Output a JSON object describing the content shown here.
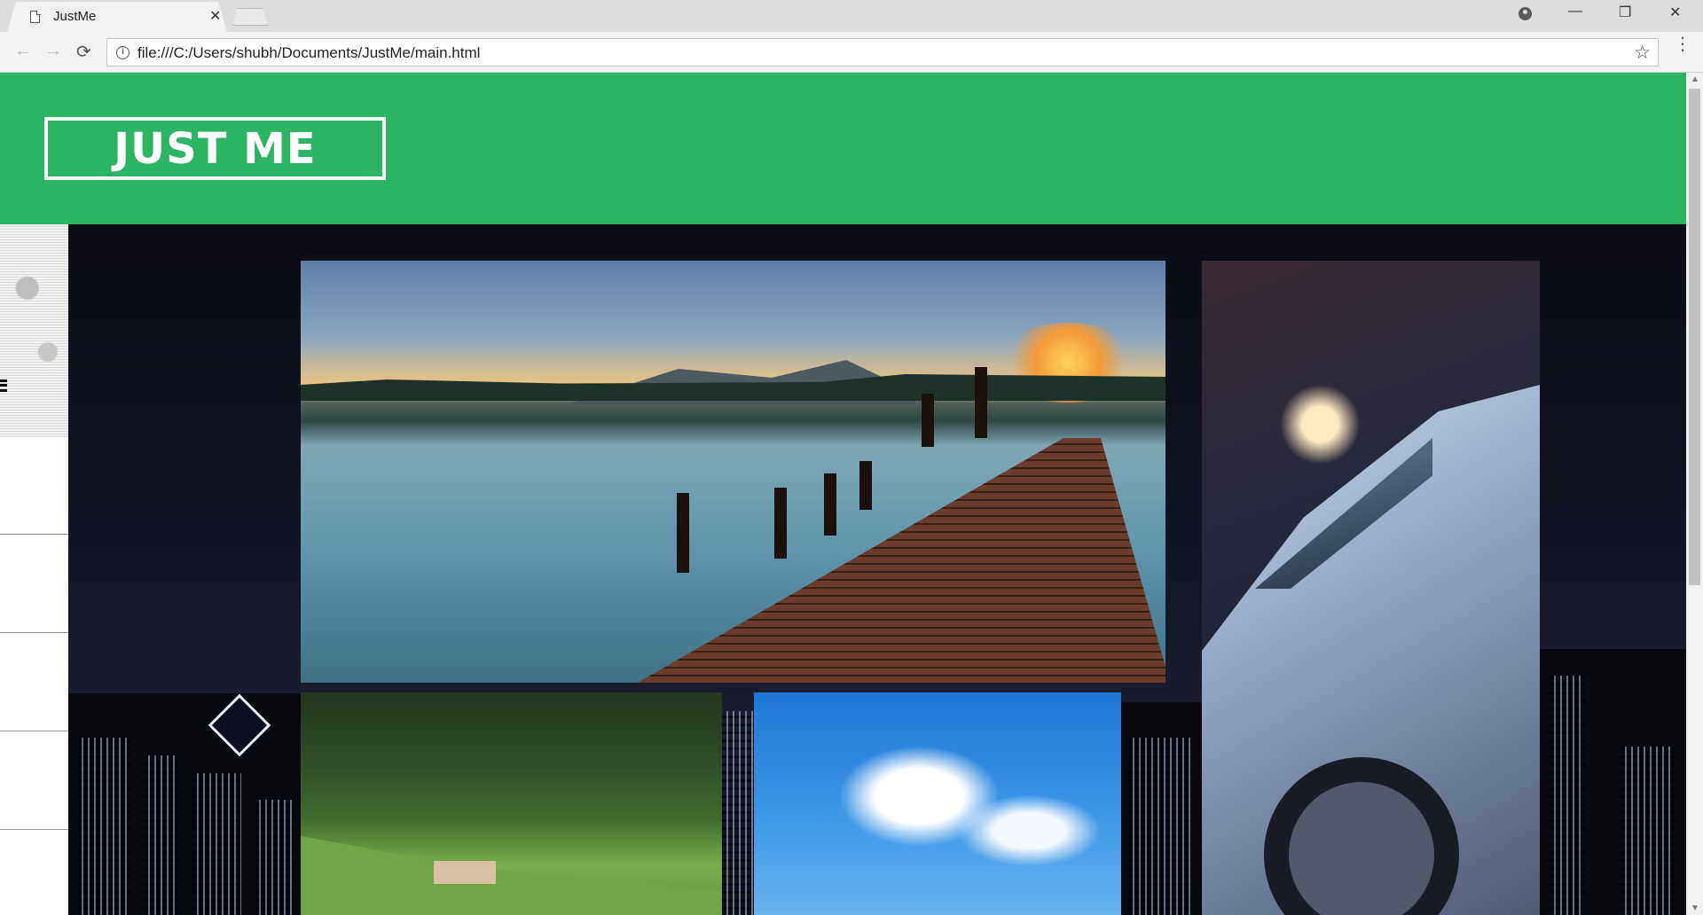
{
  "browser": {
    "tab": {
      "title": "JustMe",
      "close_glyph": "✕"
    },
    "window_controls": {
      "minimize": "—",
      "restore": "❐",
      "close": "✕"
    },
    "nav": {
      "back": "←",
      "forward": "→",
      "reload": "⟳"
    },
    "address": {
      "url": "file:///C:/Users/shubh/Documents/JustMe/main.html",
      "info_glyph": "i"
    },
    "bookmark_glyph": "☆",
    "menu_glyph": "⋮"
  },
  "page": {
    "header_color": "#2bb461",
    "logo_text": "JUST ME"
  },
  "gallery": {
    "images": [
      {
        "subject": "lake-pier-sunset"
      },
      {
        "subject": "car-night"
      },
      {
        "subject": "green-hills-house"
      },
      {
        "subject": "blue-sky-cloud"
      }
    ]
  },
  "scrollbar": {
    "up": "▲",
    "down": "▼"
  }
}
